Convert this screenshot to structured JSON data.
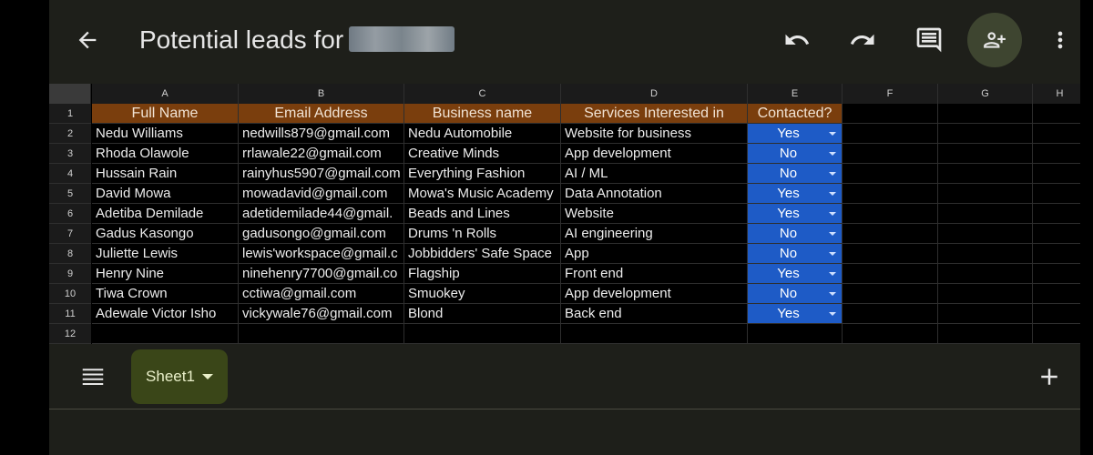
{
  "header": {
    "title": "Potential leads for",
    "title_redacted": true,
    "icons": [
      "back-arrow-icon",
      "undo-icon",
      "redo-icon",
      "comment-icon",
      "add-person-icon",
      "more-vert-icon"
    ]
  },
  "grid": {
    "column_letters": [
      "A",
      "B",
      "C",
      "D",
      "E",
      "F",
      "G",
      "H"
    ],
    "row_numbers": [
      "1",
      "2",
      "3",
      "4",
      "5",
      "6",
      "7",
      "8",
      "9",
      "10",
      "11",
      "12"
    ],
    "headers": [
      "Full Name",
      "Email Address",
      "Business name",
      "Services Interested in",
      "Contacted?"
    ],
    "rows": [
      [
        "Nedu Williams",
        "nedwills879@gmail.com",
        "Nedu Automobile",
        "Website for business",
        "Yes"
      ],
      [
        "Rhoda Olawole",
        "rrlawale22@gmail.com",
        "Creative Minds",
        "App development",
        "No"
      ],
      [
        "Hussain Rain",
        "rainyhus5907@gmail.com",
        "Everything Fashion",
        "AI / ML",
        "No"
      ],
      [
        "David Mowa",
        "mowadavid@gmail.com",
        "Mowa's Music Academy",
        "Data Annotation",
        "Yes"
      ],
      [
        "Adetiba Demilade",
        "adetidemilade44@gmail.",
        "Beads and Lines",
        "Website",
        "Yes"
      ],
      [
        "Gadus Kasongo",
        "gadusongo@gmail.com",
        "Drums 'n Rolls",
        "AI engineering",
        "No"
      ],
      [
        "Juliette Lewis",
        "lewis'workspace@gmail.c",
        "Jobbidders' Safe Space",
        "App",
        "No"
      ],
      [
        "Henry Nine",
        "ninehenry7700@gmail.co",
        "Flagship",
        "Front end",
        "Yes"
      ],
      [
        "Tiwa Crown",
        "cctiwa@gmail.com",
        "Smuokey",
        "App development",
        "No"
      ],
      [
        "Adewale Victor Isho",
        "vickywale76@gmail.com",
        "Blond",
        "Back end",
        "Yes"
      ]
    ]
  },
  "colors": {
    "header_fill": "#7a3e0d",
    "dropdown_fill": "#1e5bc6",
    "sheet_tab_fill": "#3a4618",
    "app_background": "#1e1f1a"
  },
  "sheetbar": {
    "active_sheet": "Sheet1",
    "icons": [
      "sheets-list-icon",
      "dropdown-caret-icon",
      "add-icon"
    ]
  }
}
